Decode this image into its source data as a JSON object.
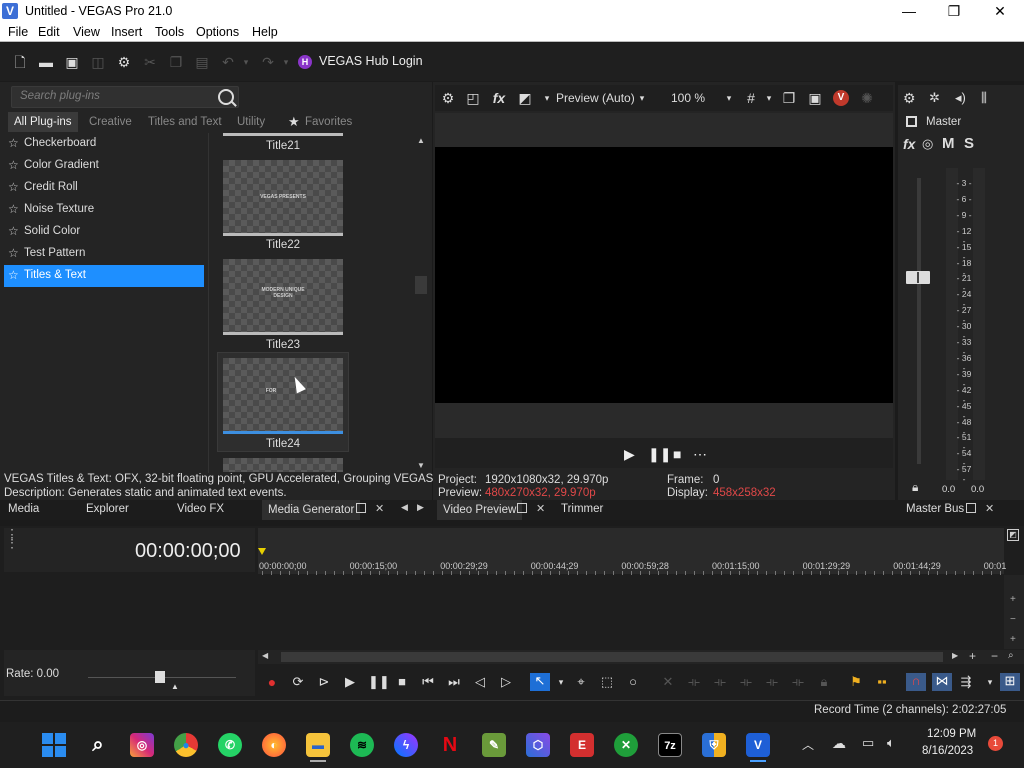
{
  "window": {
    "title": "Untitled - VEGAS Pro 21.0",
    "minimize": "—",
    "maximize": "❐",
    "close": "✕"
  },
  "menu": [
    "File",
    "Edit",
    "View",
    "Insert",
    "Tools",
    "Options",
    "Help"
  ],
  "toolbar": {
    "hub_login": "VEGAS Hub Login",
    "hub_badge": "H"
  },
  "plugins": {
    "search_placeholder": "Search plug-ins",
    "tabs": [
      "All Plug-ins",
      "Creative",
      "Titles and Text",
      "Utility",
      "Favorites"
    ],
    "categories": [
      "Checkerboard",
      "Color Gradient",
      "Credit Roll",
      "Noise Texture",
      "Solid Color",
      "Test Pattern",
      "Titles & Text"
    ],
    "selected_category": "Titles & Text",
    "presets": [
      "Title21",
      "Title22",
      "Title23",
      "Title24"
    ],
    "thumb_texts": {
      "title22": "VEGAS PRESENTS",
      "title23": "MODERN UNIQUE DESIGN",
      "title24": "FOR"
    },
    "status_line1": "VEGAS Titles & Text: OFX, 32-bit floating point, GPU Accelerated, Grouping VEGAS, V",
    "status_line2": "Description: Generates static and animated text events."
  },
  "preview": {
    "mode": "Preview (Auto)",
    "zoom": "100 %",
    "project_label": "Project:",
    "project_value": "1920x1080x32, 29.970p",
    "preview_label": "Preview:",
    "preview_value": "480x270x32, 29.970p",
    "frame_label": "Frame:",
    "frame_value": "0",
    "display_label": "Display:",
    "display_value": "458x258x32"
  },
  "mixer": {
    "master_label": "Master",
    "m": "M",
    "s": "S",
    "db_ticks": [
      "3",
      "6",
      "9",
      "12",
      "15",
      "18",
      "21",
      "24",
      "27",
      "30",
      "33",
      "36",
      "39",
      "42",
      "45",
      "48",
      "51",
      "54",
      "57"
    ],
    "peak_left": "0.0",
    "peak_right": "0.0"
  },
  "dock_tabs": {
    "media": "Media",
    "explorer": "Explorer",
    "video_fx": "Video FX",
    "media_generator": "Media Generator",
    "video_preview": "Video Preview",
    "trimmer": "Trimmer",
    "master_bus": "Master Bus"
  },
  "timeline": {
    "timecode": "00:00:00;00",
    "ruler_labels": [
      "00:00:00;00",
      "00:00:15;00",
      "00:00:29;29",
      "00:00:44;29",
      "00:00:59;28",
      "00:01:15;00",
      "00:01:29;29",
      "00:01:44;29",
      "00:01"
    ],
    "rate": "Rate: 0.00"
  },
  "status": {
    "record_time": "Record Time (2 channels): 2:02:27:05"
  },
  "taskbar": {
    "time": "12:09 PM",
    "date": "8/16/2023",
    "notification_count": "1"
  },
  "colors": {
    "accent": "#1e8fff",
    "red_value": "#e04848",
    "hub_purple": "#8a35c9"
  }
}
